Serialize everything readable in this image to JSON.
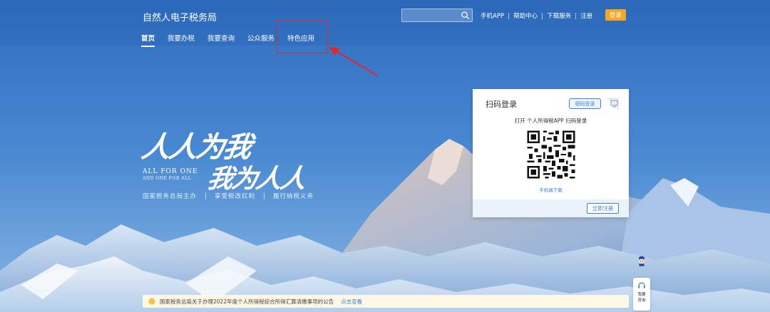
{
  "header": {
    "site_title": "自然人电子税务局",
    "search": {
      "placeholder": ""
    },
    "top_links": [
      "手机APP",
      "帮助中心",
      "下载服务",
      "注册"
    ],
    "login_label": "登录"
  },
  "nav": {
    "items": [
      {
        "label": "首页",
        "active": true
      },
      {
        "label": "我要办税",
        "active": false
      },
      {
        "label": "我要查询",
        "active": false
      },
      {
        "label": "公众服务",
        "active": false
      },
      {
        "label": "特色应用",
        "active": false
      }
    ]
  },
  "hero": {
    "slogan_line1": "人人为我",
    "slogan_line2": "我为人人",
    "slogan_en_1": "ALL FOR ONE",
    "slogan_en_2": "AND ONE FOR ALL",
    "bottom": [
      "国家税务总局主办",
      "享受税改红利",
      "履行纳税义务"
    ]
  },
  "login_card": {
    "title": "扫码登录",
    "pwd_login_label": "密码登录",
    "scan_hint": "打开 个人所得税APP 扫码登录",
    "download_link": "手机端下载",
    "register_label": "立即注册"
  },
  "notice": {
    "text": "国家税务总局关于办理2022年度个人所得税综合所得汇算清缴事项的公告",
    "link": "点击查看"
  },
  "assistant": {
    "label_1": "我要",
    "label_2": "咨询"
  },
  "colors": {
    "accent": "#3e7fd9",
    "login_button": "#f6a623",
    "highlight": "#e0282e",
    "notice_bg": "#fff8e6"
  }
}
